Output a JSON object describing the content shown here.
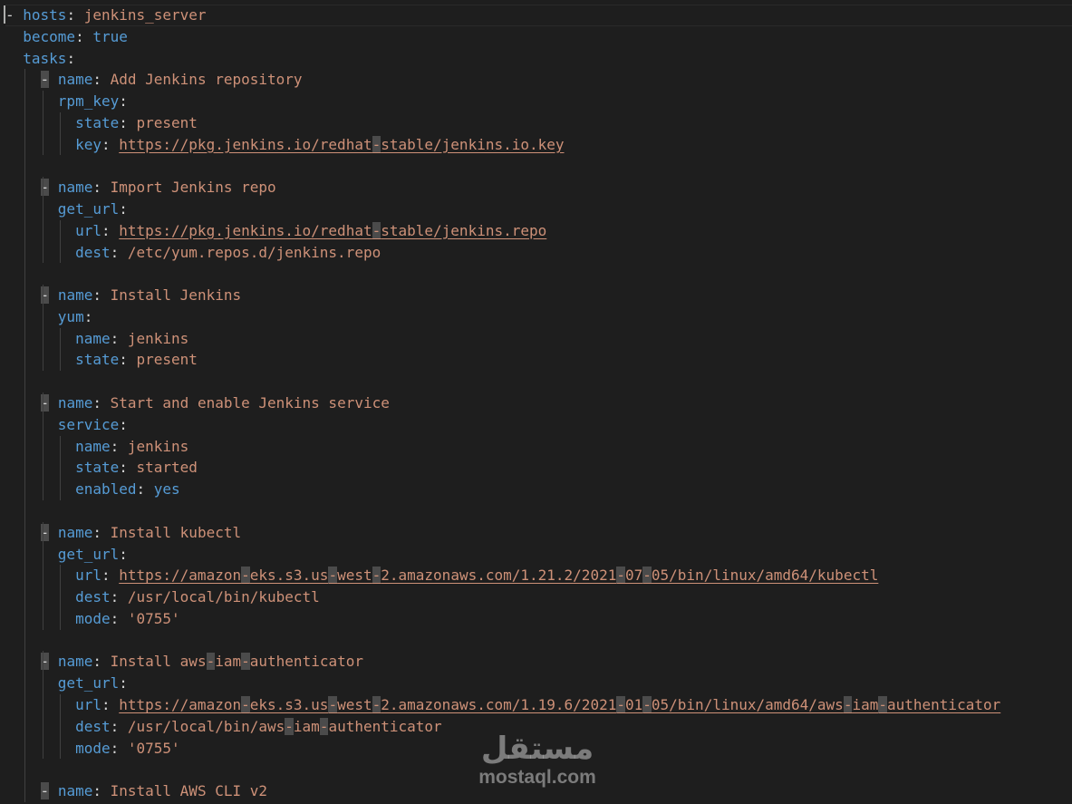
{
  "editor": {
    "top_partial_text": "- hosts: jenkins_server  # partially visible preceding line",
    "lines": [
      [
        {
          "t": "- ",
          "c": "p"
        },
        {
          "t": "hosts",
          "c": "k"
        },
        {
          "t": ": ",
          "c": "p"
        },
        {
          "t": "jenkins_server",
          "c": "s"
        }
      ],
      [
        {
          "t": "  ",
          "c": "p"
        },
        {
          "t": "become",
          "c": "k"
        },
        {
          "t": ": ",
          "c": "p"
        },
        {
          "t": "true",
          "c": "b"
        }
      ],
      [
        {
          "t": "  ",
          "c": "p"
        },
        {
          "t": "tasks",
          "c": "k"
        },
        {
          "t": ":",
          "c": "p"
        }
      ],
      [
        {
          "t": "    - ",
          "c": "p",
          "dash": true
        },
        {
          "t": "name",
          "c": "k"
        },
        {
          "t": ": ",
          "c": "p"
        },
        {
          "t": "Add Jenkins repository",
          "c": "s"
        }
      ],
      [
        {
          "t": "      ",
          "c": "p"
        },
        {
          "t": "rpm_key",
          "c": "k"
        },
        {
          "t": ":",
          "c": "p"
        }
      ],
      [
        {
          "t": "        ",
          "c": "p"
        },
        {
          "t": "state",
          "c": "k"
        },
        {
          "t": ": ",
          "c": "p"
        },
        {
          "t": "present",
          "c": "s"
        }
      ],
      [
        {
          "t": "        ",
          "c": "p"
        },
        {
          "t": "key",
          "c": "k"
        },
        {
          "t": ": ",
          "c": "p"
        },
        {
          "t": "https://pkg.jenkins.io/redhat",
          "c": "url"
        },
        {
          "t": "-",
          "c": "url hl"
        },
        {
          "t": "stable/jenkins.io.key",
          "c": "url"
        }
      ],
      [],
      [
        {
          "t": "    - ",
          "c": "p",
          "dash": true
        },
        {
          "t": "name",
          "c": "k"
        },
        {
          "t": ": ",
          "c": "p"
        },
        {
          "t": "Import Jenkins repo",
          "c": "s"
        }
      ],
      [
        {
          "t": "      ",
          "c": "p"
        },
        {
          "t": "get_url",
          "c": "k"
        },
        {
          "t": ":",
          "c": "p"
        }
      ],
      [
        {
          "t": "        ",
          "c": "p"
        },
        {
          "t": "url",
          "c": "k"
        },
        {
          "t": ": ",
          "c": "p"
        },
        {
          "t": "https://pkg.jenkins.io/redhat",
          "c": "url"
        },
        {
          "t": "-",
          "c": "url hl"
        },
        {
          "t": "stable/jenkins.repo",
          "c": "url"
        }
      ],
      [
        {
          "t": "        ",
          "c": "p"
        },
        {
          "t": "dest",
          "c": "k"
        },
        {
          "t": ": ",
          "c": "p"
        },
        {
          "t": "/etc/yum.repos.d/jenkins.repo",
          "c": "s"
        }
      ],
      [],
      [
        {
          "t": "    - ",
          "c": "p",
          "dash": true
        },
        {
          "t": "name",
          "c": "k"
        },
        {
          "t": ": ",
          "c": "p"
        },
        {
          "t": "Install Jenkins",
          "c": "s"
        }
      ],
      [
        {
          "t": "      ",
          "c": "p"
        },
        {
          "t": "yum",
          "c": "k"
        },
        {
          "t": ":",
          "c": "p"
        }
      ],
      [
        {
          "t": "        ",
          "c": "p"
        },
        {
          "t": "name",
          "c": "k"
        },
        {
          "t": ": ",
          "c": "p"
        },
        {
          "t": "jenkins",
          "c": "s"
        }
      ],
      [
        {
          "t": "        ",
          "c": "p"
        },
        {
          "t": "state",
          "c": "k"
        },
        {
          "t": ": ",
          "c": "p"
        },
        {
          "t": "present",
          "c": "s"
        }
      ],
      [],
      [
        {
          "t": "    - ",
          "c": "p",
          "dash": true
        },
        {
          "t": "name",
          "c": "k"
        },
        {
          "t": ": ",
          "c": "p"
        },
        {
          "t": "Start and enable Jenkins service",
          "c": "s"
        }
      ],
      [
        {
          "t": "      ",
          "c": "p"
        },
        {
          "t": "service",
          "c": "k"
        },
        {
          "t": ":",
          "c": "p"
        }
      ],
      [
        {
          "t": "        ",
          "c": "p"
        },
        {
          "t": "name",
          "c": "k"
        },
        {
          "t": ": ",
          "c": "p"
        },
        {
          "t": "jenkins",
          "c": "s"
        }
      ],
      [
        {
          "t": "        ",
          "c": "p"
        },
        {
          "t": "state",
          "c": "k"
        },
        {
          "t": ": ",
          "c": "p"
        },
        {
          "t": "started",
          "c": "s"
        }
      ],
      [
        {
          "t": "        ",
          "c": "p"
        },
        {
          "t": "enabled",
          "c": "k"
        },
        {
          "t": ": ",
          "c": "p"
        },
        {
          "t": "yes",
          "c": "b"
        }
      ],
      [],
      [
        {
          "t": "    - ",
          "c": "p",
          "dash": true
        },
        {
          "t": "name",
          "c": "k"
        },
        {
          "t": ": ",
          "c": "p"
        },
        {
          "t": "Install kubectl",
          "c": "s"
        }
      ],
      [
        {
          "t": "      ",
          "c": "p"
        },
        {
          "t": "get_url",
          "c": "k"
        },
        {
          "t": ":",
          "c": "p"
        }
      ],
      [
        {
          "t": "        ",
          "c": "p"
        },
        {
          "t": "url",
          "c": "k"
        },
        {
          "t": ": ",
          "c": "p"
        },
        {
          "t": "https://amazon",
          "c": "url"
        },
        {
          "t": "-",
          "c": "url hl"
        },
        {
          "t": "eks.s3.us",
          "c": "url"
        },
        {
          "t": "-",
          "c": "url hl"
        },
        {
          "t": "west",
          "c": "url"
        },
        {
          "t": "-",
          "c": "url hl"
        },
        {
          "t": "2.amazonaws.com/1.21.2/2021",
          "c": "url"
        },
        {
          "t": "-",
          "c": "url hl"
        },
        {
          "t": "07",
          "c": "url"
        },
        {
          "t": "-",
          "c": "url hl"
        },
        {
          "t": "05/bin/linux/amd64/kubectl",
          "c": "url"
        }
      ],
      [
        {
          "t": "        ",
          "c": "p"
        },
        {
          "t": "dest",
          "c": "k"
        },
        {
          "t": ": ",
          "c": "p"
        },
        {
          "t": "/usr/local/bin/kubectl",
          "c": "s"
        }
      ],
      [
        {
          "t": "        ",
          "c": "p"
        },
        {
          "t": "mode",
          "c": "k"
        },
        {
          "t": ": ",
          "c": "p"
        },
        {
          "t": "'0755'",
          "c": "s"
        }
      ],
      [],
      [
        {
          "t": "    - ",
          "c": "p",
          "dash": true
        },
        {
          "t": "name",
          "c": "k"
        },
        {
          "t": ": ",
          "c": "p"
        },
        {
          "t": "Install aws",
          "c": "s"
        },
        {
          "t": "-",
          "c": "s hl"
        },
        {
          "t": "iam",
          "c": "s"
        },
        {
          "t": "-",
          "c": "s hl"
        },
        {
          "t": "authenticator",
          "c": "s"
        }
      ],
      [
        {
          "t": "      ",
          "c": "p"
        },
        {
          "t": "get_url",
          "c": "k"
        },
        {
          "t": ":",
          "c": "p"
        }
      ],
      [
        {
          "t": "        ",
          "c": "p"
        },
        {
          "t": "url",
          "c": "k"
        },
        {
          "t": ": ",
          "c": "p"
        },
        {
          "t": "https://amazon",
          "c": "url"
        },
        {
          "t": "-",
          "c": "url hl"
        },
        {
          "t": "eks.s3.us",
          "c": "url"
        },
        {
          "t": "-",
          "c": "url hl"
        },
        {
          "t": "west",
          "c": "url"
        },
        {
          "t": "-",
          "c": "url hl"
        },
        {
          "t": "2.amazonaws.com/1.19.6/2021",
          "c": "url"
        },
        {
          "t": "-",
          "c": "url hl"
        },
        {
          "t": "01",
          "c": "url"
        },
        {
          "t": "-",
          "c": "url hl"
        },
        {
          "t": "05/bin/linux/amd64/aws",
          "c": "url"
        },
        {
          "t": "-",
          "c": "url hl"
        },
        {
          "t": "iam",
          "c": "url"
        },
        {
          "t": "-",
          "c": "url hl"
        },
        {
          "t": "authenticator",
          "c": "url"
        }
      ],
      [
        {
          "t": "        ",
          "c": "p"
        },
        {
          "t": "dest",
          "c": "k"
        },
        {
          "t": ": ",
          "c": "p"
        },
        {
          "t": "/usr/local/bin/aws",
          "c": "s"
        },
        {
          "t": "-",
          "c": "s hl"
        },
        {
          "t": "iam",
          "c": "s"
        },
        {
          "t": "-",
          "c": "s hl"
        },
        {
          "t": "authenticator",
          "c": "s"
        }
      ],
      [
        {
          "t": "        ",
          "c": "p"
        },
        {
          "t": "mode",
          "c": "k"
        },
        {
          "t": ": ",
          "c": "p"
        },
        {
          "t": "'0755'",
          "c": "s"
        }
      ],
      [],
      [
        {
          "t": "    - ",
          "c": "p",
          "dash": true
        },
        {
          "t": "name",
          "c": "k"
        },
        {
          "t": ": ",
          "c": "p"
        },
        {
          "t": "Install AWS CLI v2",
          "c": "s"
        }
      ]
    ]
  },
  "watermark": {
    "arabic": "مستقل",
    "latin": "mostaql.com"
  },
  "colors": {
    "background": "#1e1e1e",
    "key": "#569cd6",
    "string": "#ce9178",
    "punct": "#d4d4d4",
    "dash_highlight": "#4b4b4b"
  }
}
